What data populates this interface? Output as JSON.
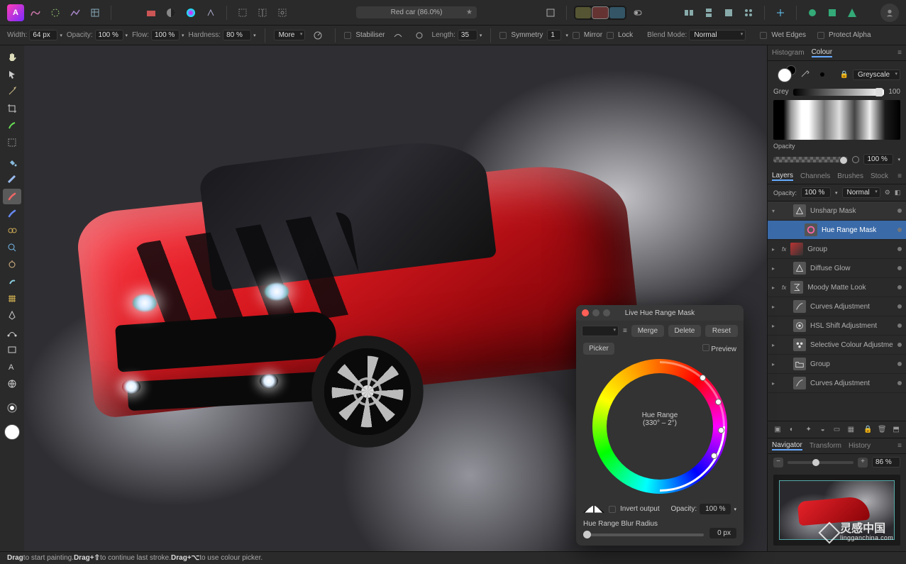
{
  "document": {
    "title": "Red car (86.0%)"
  },
  "options": {
    "width_label": "Width:",
    "width": "64 px",
    "opacity_label": "Opacity:",
    "opacity": "100 %",
    "flow_label": "Flow:",
    "flow": "100 %",
    "hardness_label": "Hardness:",
    "hardness": "80 %",
    "more": "More",
    "stabiliser": "Stabiliser",
    "length_label": "Length:",
    "length": "35",
    "symmetry": "Symmetry",
    "symmetry_val": "1",
    "mirror": "Mirror",
    "lock": "Lock",
    "blend_label": "Blend Mode:",
    "blend": "Normal",
    "wet_edges": "Wet Edges",
    "protect_alpha": "Protect Alpha"
  },
  "colour": {
    "tab_histogram": "Histogram",
    "tab_colour": "Colour",
    "mode": "Greyscale",
    "grey_label": "Grey",
    "grey": "100",
    "opacity_label": "Opacity",
    "opacity": "100 %"
  },
  "layers_tabs": {
    "layers": "Layers",
    "channels": "Channels",
    "brushes": "Brushes",
    "stock": "Stock"
  },
  "layers_ctrl": {
    "opacity_label": "Opacity:",
    "opacity": "100 %",
    "blend": "Normal"
  },
  "layers": [
    {
      "name": "Unsharp Mask",
      "kind": "adj-triangle",
      "parent": true,
      "arrow": "▾"
    },
    {
      "name": "Hue Range Mask",
      "kind": "hue",
      "selected": true,
      "indent": 1
    },
    {
      "name": "Group",
      "kind": "img",
      "arrow": "▸",
      "fx": "fx"
    },
    {
      "name": "Diffuse Glow",
      "kind": "adj-triangle",
      "arrow": "▸"
    },
    {
      "name": "Moody Matte Look",
      "kind": "sum",
      "arrow": "▸",
      "fx": "fx"
    },
    {
      "name": "Curves Adjustment",
      "kind": "curve",
      "arrow": "▸"
    },
    {
      "name": "HSL Shift Adjustment",
      "kind": "hsl",
      "arrow": "▸"
    },
    {
      "name": "Selective Colour Adjustment",
      "kind": "sel",
      "arrow": "▸"
    },
    {
      "name": "Group",
      "kind": "folder",
      "arrow": "▸"
    },
    {
      "name": "Curves Adjustment",
      "kind": "curve",
      "arrow": "▸"
    }
  ],
  "nav": {
    "tab_nav": "Navigator",
    "tab_transform": "Transform",
    "tab_history": "History",
    "zoom": "86 %"
  },
  "dialog": {
    "title": "Live Hue Range Mask",
    "merge": "Merge",
    "delete": "Delete",
    "reset": "Reset",
    "picker": "Picker",
    "preview": "Preview",
    "range_label": "Hue Range",
    "range_value": "(330° – 2°)",
    "invert": "Invert output",
    "opacity_label": "Opacity:",
    "opacity": "100 %",
    "blur_label": "Hue Range Blur Radius",
    "blur": "0 px"
  },
  "status": {
    "drag": "Drag",
    "drag_txt": " to start painting. ",
    "dragshift": "Drag+⇧",
    "dragshift_txt": " to continue last stroke. ",
    "dragalt": "Drag+⌥",
    "dragalt_txt": " to use colour picker."
  },
  "watermark": {
    "cn": "灵感中国",
    "en": "lingganchina.com"
  }
}
